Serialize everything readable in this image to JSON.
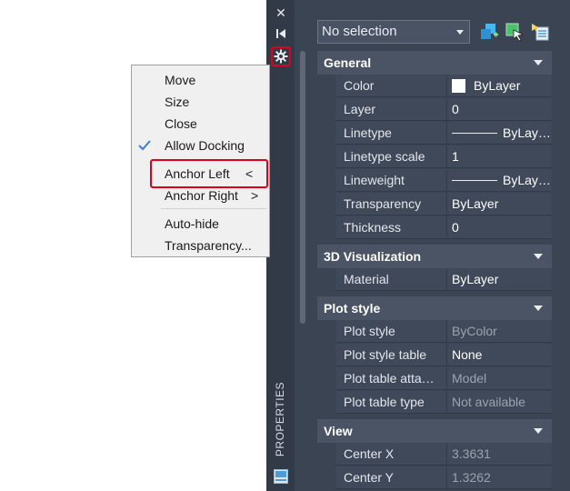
{
  "palette": {
    "title_vertical": "PROPERTIES",
    "titlebar_icons": [
      "close-icon",
      "auto-hide-icon",
      "properties-gear-icon"
    ],
    "selection": "No selection",
    "toolbar_icons": [
      "toggle-pickadd-icon",
      "select-objects-icon",
      "quick-select-icon"
    ]
  },
  "sections": {
    "general": {
      "title": "General",
      "rows": [
        {
          "name": "Color",
          "value": "ByLayer"
        },
        {
          "name": "Layer",
          "value": "0"
        },
        {
          "name": "Linetype",
          "value": "ByLay…"
        },
        {
          "name": "Linetype scale",
          "value": "1"
        },
        {
          "name": "Lineweight",
          "value": "ByLay…"
        },
        {
          "name": "Transparency",
          "value": "ByLayer"
        },
        {
          "name": "Thickness",
          "value": "0"
        }
      ]
    },
    "viz": {
      "title": "3D Visualization",
      "rows": [
        {
          "name": "Material",
          "value": "ByLayer"
        }
      ]
    },
    "plot": {
      "title": "Plot style",
      "rows": [
        {
          "name": "Plot style",
          "value": "ByColor"
        },
        {
          "name": "Plot style table",
          "value": "None"
        },
        {
          "name": "Plot table atta…",
          "value": "Model"
        },
        {
          "name": "Plot table type",
          "value": "Not available"
        }
      ]
    },
    "view": {
      "title": "View",
      "rows": [
        {
          "name": "Center X",
          "value": "3.3631"
        },
        {
          "name": "Center Y",
          "value": "1.3262"
        }
      ]
    }
  },
  "menu": {
    "items": [
      {
        "label": "Move"
      },
      {
        "label": "Size"
      },
      {
        "label": "Close"
      },
      {
        "label": "Allow Docking",
        "checked": true
      },
      {
        "label": "Anchor Left",
        "suffix": "<"
      },
      {
        "label": "Anchor Right",
        "suffix": ">"
      },
      {
        "label": "Auto-hide"
      },
      {
        "label": "Transparency..."
      }
    ]
  },
  "colors": {
    "highlight": "#e0001b",
    "check": "#3b7dd8",
    "palette_bg": "#3b4453"
  }
}
